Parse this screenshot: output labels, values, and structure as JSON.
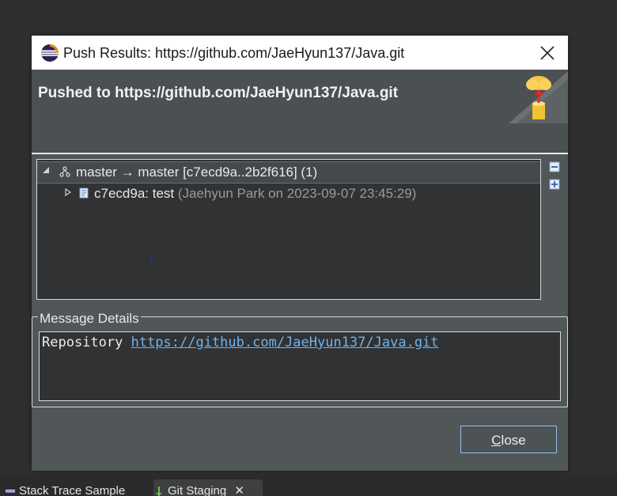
{
  "dialog": {
    "title": "Push Results: https://github.com/JaeHyun137/Java.git",
    "heading": "Pushed to https://github.com/JaeHyun137/Java.git"
  },
  "tree": {
    "rows": [
      {
        "label": "master → master [c7ecd9a..2b2f616] (1)",
        "detail": "",
        "expanded": true,
        "icon": "branch-icon"
      },
      {
        "label": "c7ecd9a: test ",
        "detail": "(Jaehyun Park on 2023-09-07 23:45:29)",
        "expanded": false,
        "icon": "commit-icon"
      }
    ]
  },
  "message_details": {
    "label": "Message Details",
    "prefix": "Repository ",
    "link": "https://github.com/JaeHyun137/Java.git"
  },
  "buttons": {
    "close_mnemonic": "C",
    "close_rest": "lose"
  },
  "bottom_tabs": [
    {
      "label": "Stack Trace Sample"
    },
    {
      "label": "Git Staging"
    }
  ],
  "colors": {
    "accent": "#8ec2ee",
    "link": "#6fb4ee",
    "dialog_bg": "#515658"
  }
}
